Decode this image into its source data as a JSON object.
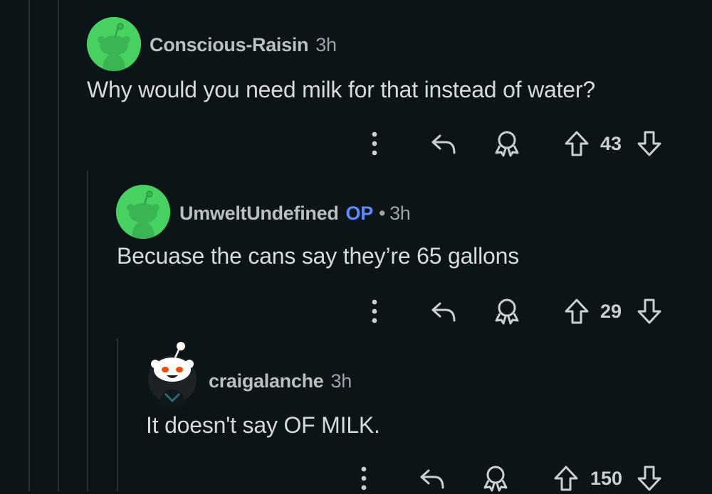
{
  "comments": [
    {
      "username": "Conscious-Raisin",
      "op_badge": "",
      "time": "3h",
      "text": "Why would you need milk for that instead of water?",
      "score": "43",
      "avatar": "green-snoo-avatar"
    },
    {
      "username": "UmweltUndefined",
      "op_badge": "OP",
      "separator": "•",
      "time": "3h",
      "text": "Becuase the cans say they’re 65 gallons",
      "score": "29",
      "avatar": "green-snoo-avatar"
    },
    {
      "username": "craigalanche",
      "op_badge": "",
      "time": "3h",
      "text": "It doesn't say OF MILK.",
      "score": "150",
      "avatar": "white-snoo-avatar"
    }
  ],
  "icons": {
    "more": "more-vertical-icon",
    "reply": "reply-icon",
    "award": "award-icon",
    "upvote": "upvote-icon",
    "downvote": "downvote-icon"
  },
  "colors": {
    "background": "#0b1416",
    "username": "#b8bfc5",
    "op": "#5c8dff",
    "avatar_green": "#46d160"
  }
}
